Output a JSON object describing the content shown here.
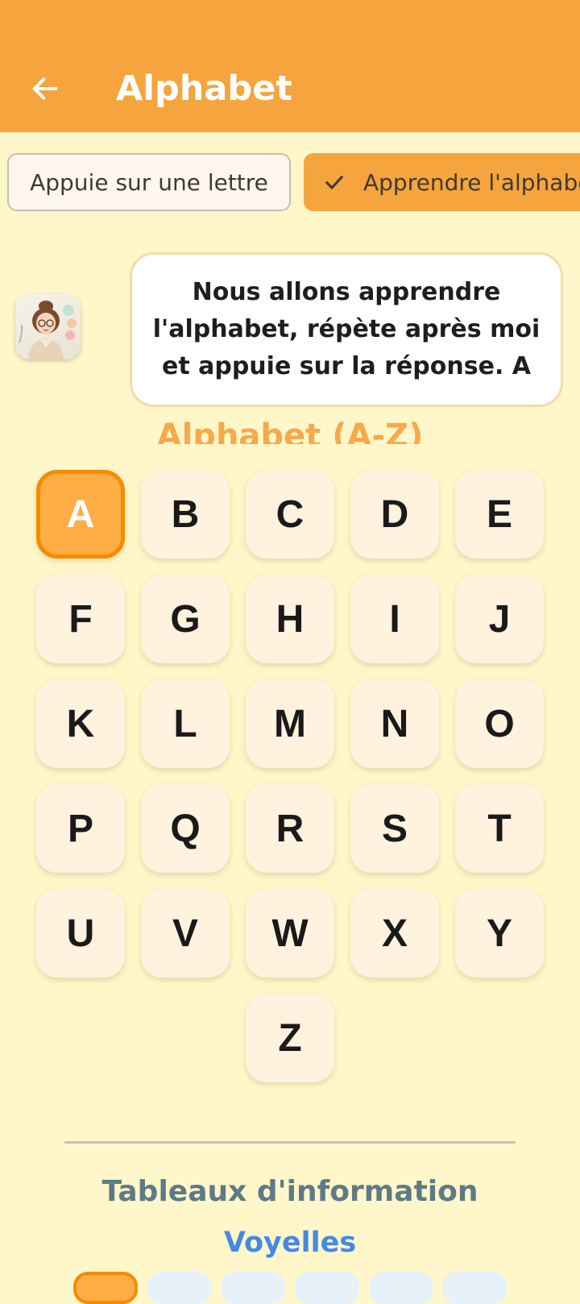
{
  "app_bar": {
    "title": "Alphabet",
    "back_icon": "arrow-left-icon",
    "color": "#F5A43E"
  },
  "modes": [
    {
      "label": "Appuie sur une lettre",
      "selected": false
    },
    {
      "label": "Apprendre l'alphabet",
      "selected": true,
      "icon": "check-icon"
    }
  ],
  "tutor": {
    "message": "Nous allons apprendre l'alphabet, répète après moi et appuie sur la réponse. A"
  },
  "alphabet_section": {
    "title": "Alphabet (A-Z)",
    "active_letter": "A",
    "letters": [
      "A",
      "B",
      "C",
      "D",
      "E",
      "F",
      "G",
      "H",
      "I",
      "J",
      "K",
      "L",
      "M",
      "N",
      "O",
      "P",
      "Q",
      "R",
      "S",
      "T",
      "U",
      "V",
      "W",
      "X",
      "Y",
      "Z"
    ]
  },
  "info_section": {
    "title": "Tableaux d'information",
    "vowels_title": "Voyelles"
  },
  "colors": {
    "background": "#FFF7C9",
    "accent": "#F5A43E",
    "key_background": "#FFF2DE",
    "active_key": "#FFAD45",
    "vowels_title": "#4489E5",
    "info_title": "#5F7A86"
  }
}
